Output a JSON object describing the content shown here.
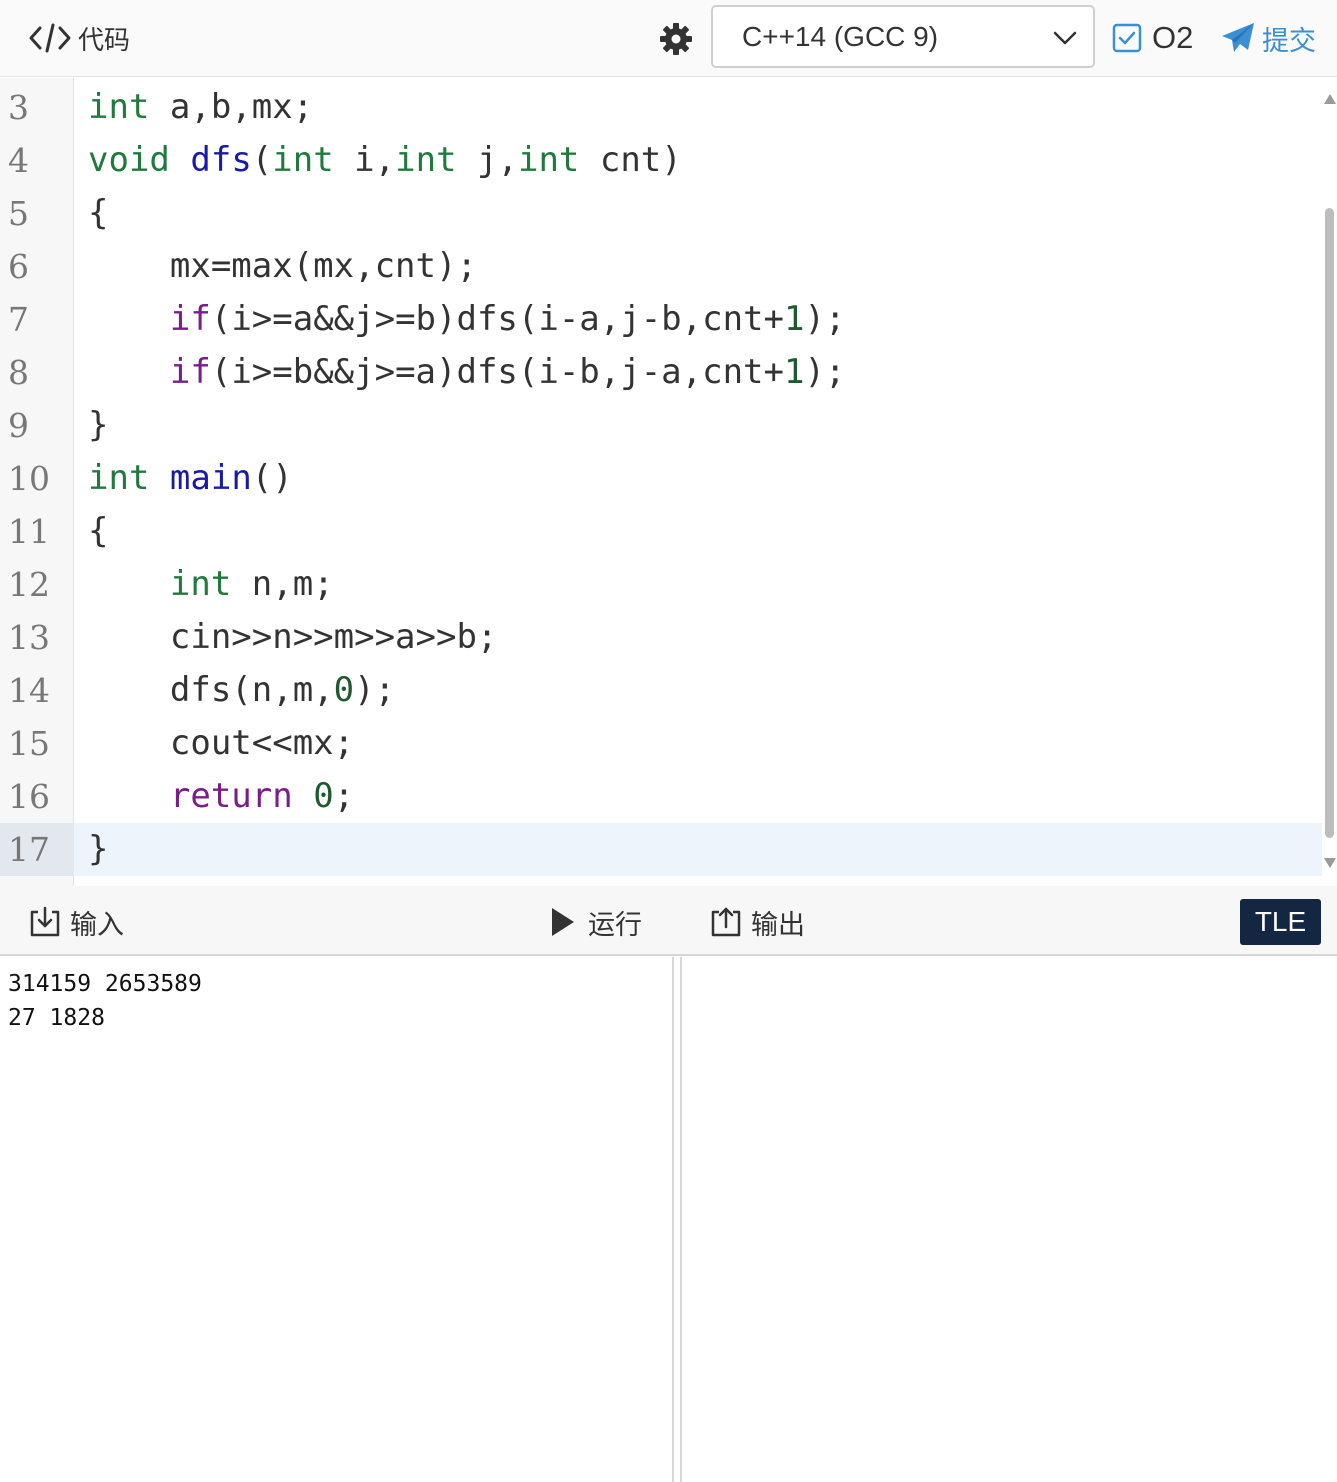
{
  "header": {
    "title": "代码",
    "language": "C++14 (GCC 9)",
    "o2_label": "O2",
    "o2_checked": true,
    "submit_label": "提交",
    "accent_color": "#3b8fd4"
  },
  "editor": {
    "active_line": 17,
    "lines": [
      {
        "num": "3",
        "code": "int a,b,mx;"
      },
      {
        "num": "4",
        "code": "void dfs(int i,int j,int cnt)"
      },
      {
        "num": "5",
        "code": "{"
      },
      {
        "num": "6",
        "code": "    mx=max(mx,cnt);"
      },
      {
        "num": "7",
        "code": "    if(i>=a&&j>=b)dfs(i-a,j-b,cnt+1);"
      },
      {
        "num": "8",
        "code": "    if(i>=b&&j>=a)dfs(i-b,j-a,cnt+1);"
      },
      {
        "num": "9",
        "code": "}"
      },
      {
        "num": "10",
        "code": "int main()"
      },
      {
        "num": "11",
        "code": "{"
      },
      {
        "num": "12",
        "code": "    int n,m;"
      },
      {
        "num": "13",
        "code": "    cin>>n>>m>>a>>b;"
      },
      {
        "num": "14",
        "code": "    dfs(n,m,0);"
      },
      {
        "num": "15",
        "code": "    cout<<mx;"
      },
      {
        "num": "16",
        "code": "    return 0;"
      },
      {
        "num": "17",
        "code": "}"
      }
    ]
  },
  "io": {
    "input_label": "输入",
    "run_label": "运行",
    "output_label": "输出",
    "status": "TLE",
    "status_color": "#132742",
    "input_text": "314159 2653589\n27 1828",
    "output_text": ""
  },
  "icons": {
    "title": "code-brackets-icon",
    "settings": "gear-icon",
    "dropdown": "chevron-down-icon",
    "o2": "checkbox-checked-icon",
    "submit": "paper-plane-icon",
    "input": "download-tray-icon",
    "run": "play-icon",
    "output": "upload-tray-icon"
  }
}
